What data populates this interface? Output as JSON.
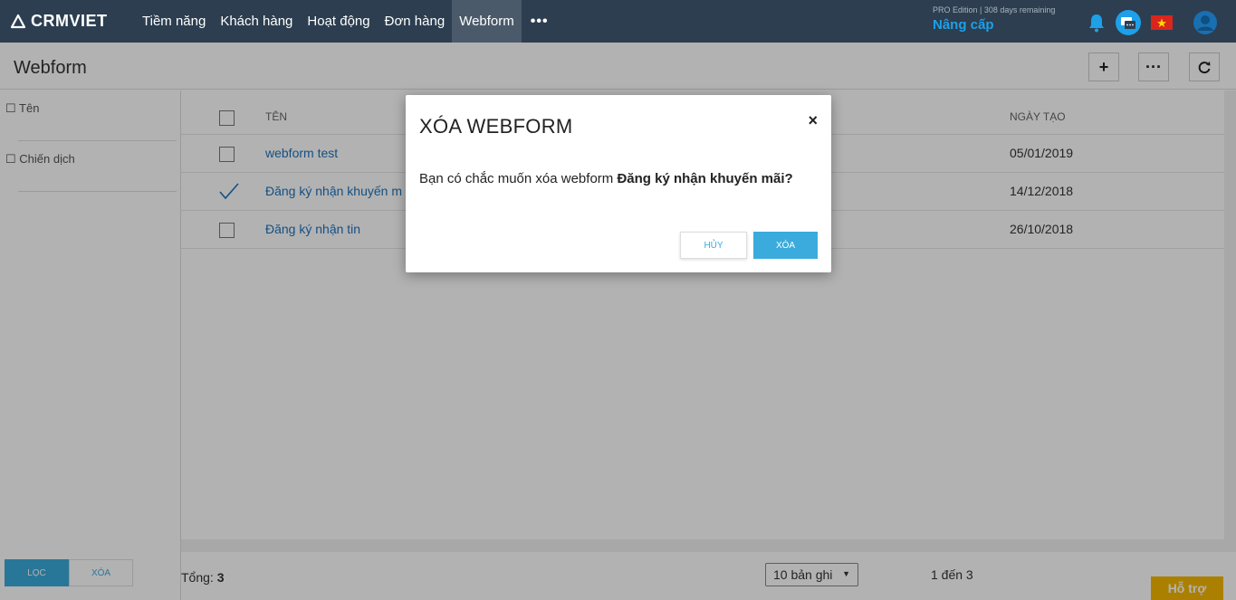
{
  "app": {
    "logo": "CRMVIET",
    "nav": [
      "Tiềm năng",
      "Khách hàng",
      "Hoạt động",
      "Đơn hàng",
      "Webform"
    ],
    "nav_more": "•••",
    "edition": "PRO Edition | 308 days remaining",
    "upgrade": "Nâng cấp"
  },
  "page": {
    "title": "Webform",
    "add_button": "+",
    "more_button": "···",
    "refresh_button": "⟳"
  },
  "filters": {
    "items": [
      "☐ Tên",
      "☐ Chiến dịch"
    ],
    "apply_label": "LỌC",
    "clear_label": "XÓA"
  },
  "table": {
    "columns": [
      "TÊN",
      "NGÀY TẠO"
    ],
    "rows": [
      {
        "name": "webform test",
        "date": "05/01/2019",
        "checked": false
      },
      {
        "name": "Đăng ký nhận khuyến m",
        "date": "14/12/2018",
        "checked": true
      },
      {
        "name": "Đăng ký nhận tin",
        "date": "26/10/2018",
        "checked": false
      }
    ]
  },
  "footer": {
    "total_label": "Tổng:",
    "total_value": "3",
    "page_size": "10 bản ghi",
    "range": "1 đến 3",
    "help": "Hỗ trợ"
  },
  "modal": {
    "title": "XÓA WEBFORM",
    "close": "×",
    "message": "Bạn có chắc muốn xóa webform",
    "item": "Đăng ký nhận khuyến mãi?",
    "cancel_label": "HỦY",
    "confirm_label": "XÓA"
  },
  "colors": {
    "topbar": "#2c3e50",
    "accent": "#3aabdc",
    "link": "#1e73be",
    "help": "#f5b800"
  }
}
